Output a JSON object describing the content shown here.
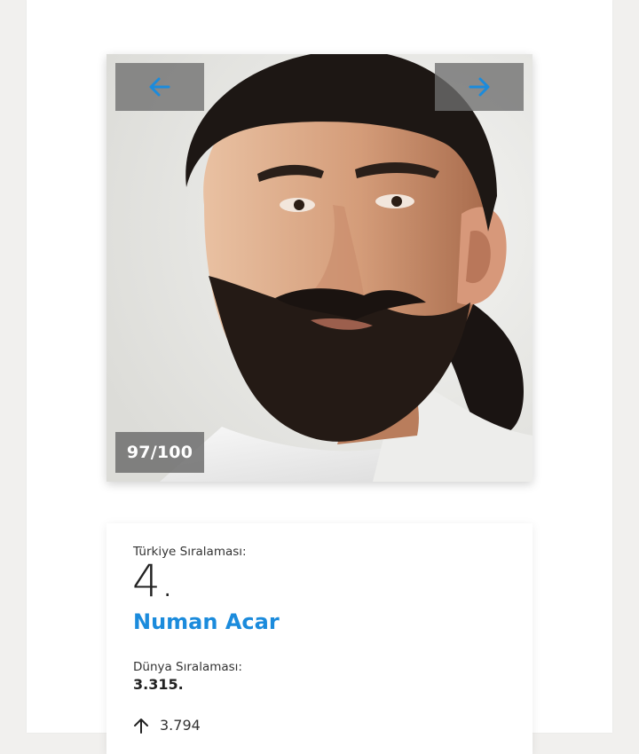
{
  "slider": {
    "counter": "97/100",
    "prev_icon": "arrow-left-icon",
    "next_icon": "arrow-right-icon",
    "accent_color": "#1b8bdc"
  },
  "profile": {
    "turkey_rank_label": "Türkiye Sıralaması:",
    "turkey_rank_value": "4.",
    "name": "Numan Acar",
    "world_rank_label": "Dünya Sıralaması:",
    "world_rank_value": "3.315.",
    "trend_icon": "arrow-up-icon",
    "trend_value": "3.794"
  }
}
